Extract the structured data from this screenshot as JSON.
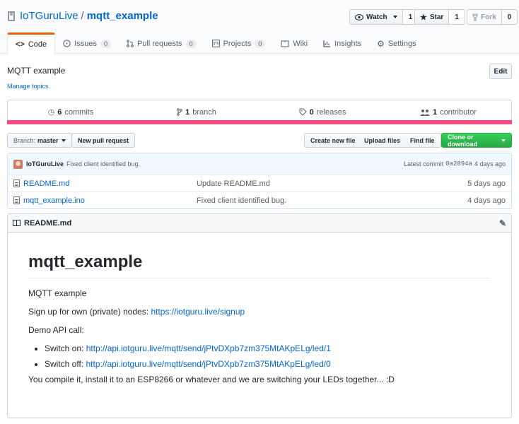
{
  "repo": {
    "owner": "IoTGuruLive",
    "separator": "/",
    "name": "mqtt_example"
  },
  "actions": {
    "watch_label": "Watch",
    "watch_count": "1",
    "star_label": "Star",
    "star_count": "1",
    "fork_label": "Fork",
    "fork_count": "0"
  },
  "tabs": [
    {
      "label": "Code"
    },
    {
      "label": "Issues",
      "count": "0"
    },
    {
      "label": "Pull requests",
      "count": "0"
    },
    {
      "label": "Projects",
      "count": "0"
    },
    {
      "label": "Wiki"
    },
    {
      "label": "Insights"
    },
    {
      "label": "Settings"
    }
  ],
  "description": "MQTT example",
  "manage_topics": "Manage topics",
  "edit_label": "Edit",
  "summary": {
    "commits_count": "6",
    "commits_label": "commits",
    "branch_count": "1",
    "branch_label": "branch",
    "releases_count": "0",
    "releases_label": "releases",
    "contributors_count": "1",
    "contributors_label": "contributor"
  },
  "toolbar": {
    "branch_prefix": "Branch:",
    "branch_name": "master",
    "new_pr": "New pull request",
    "create_file": "Create new file",
    "upload_files": "Upload files",
    "find_file": "Find file",
    "clone": "Clone or download"
  },
  "latest_commit": {
    "author": "IoTGuruLive",
    "message": "Fixed client identified bug.",
    "label": "Latest commit",
    "sha": "0a2894a",
    "age": "4 days ago"
  },
  "files": [
    {
      "name": "README.md",
      "message": "Update README.md",
      "age": "5 days ago"
    },
    {
      "name": "mqtt_example.ino",
      "message": "Fixed client identified bug.",
      "age": "4 days ago"
    }
  ],
  "readme": {
    "filename": "README.md",
    "title": "mqtt_example",
    "p1": "MQTT example",
    "p2_text": "Sign up for own (private) nodes: ",
    "p2_link": "https://iotguru.live/signup",
    "p3": "Demo API call:",
    "items": [
      {
        "text": "Switch on: ",
        "link": "http://api.iotguru.live/mqtt/send/jPtvDXpb7zm375MtAKpELg/led/1"
      },
      {
        "text": "Switch off: ",
        "link": "http://api.iotguru.live/mqtt/send/jPtvDXpb7zm375MtAKpELg/led/0"
      }
    ],
    "p4": "You compile it, install it to an ESP8266 or whatever and we are switching your LEDs together... :D"
  },
  "colors": {
    "accent_link": "#0366d6",
    "tab_active": "#e36209",
    "language_bar": "#f34b7d",
    "clone_button": "#28a745"
  },
  "icons": [
    "repo-book-icon",
    "eye-icon",
    "star-icon",
    "fork-icon",
    "code-icon",
    "issue-icon",
    "pull-request-icon",
    "project-icon",
    "wiki-icon",
    "graph-icon",
    "gear-icon",
    "history-icon",
    "branch-icon",
    "tag-icon",
    "people-icon",
    "file-icon",
    "book-icon",
    "pencil-icon"
  ]
}
